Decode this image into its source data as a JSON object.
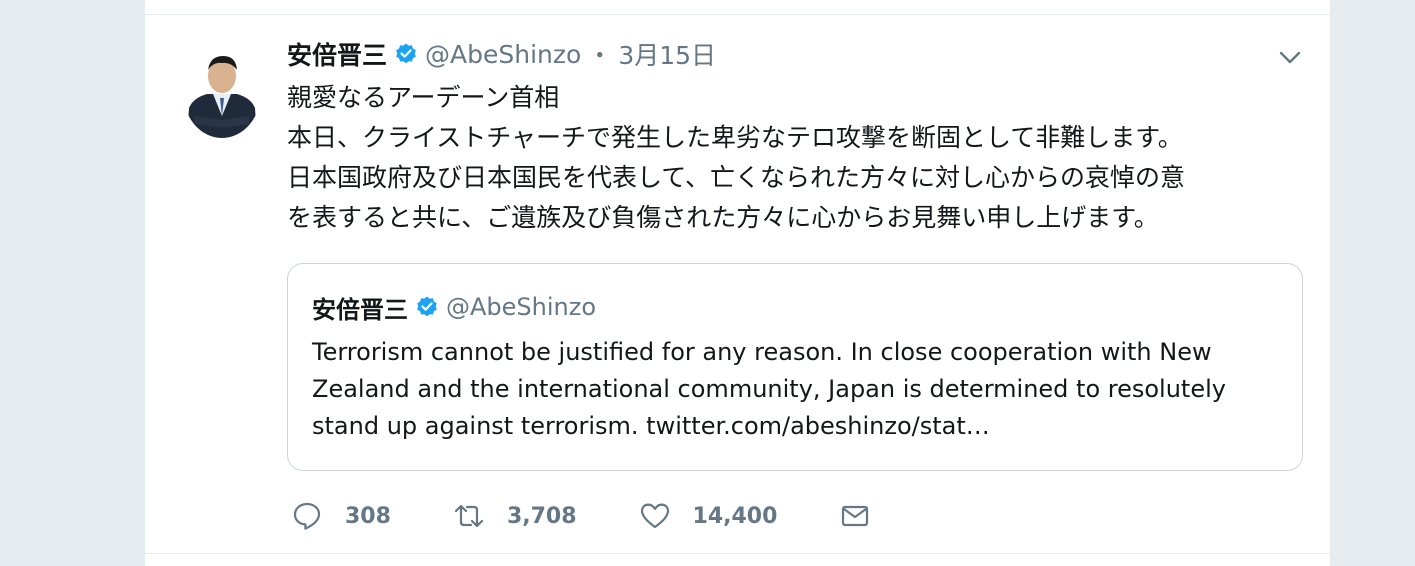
{
  "tweet": {
    "author_name": "安倍晋三",
    "handle": "@AbeShinzo",
    "separator": "・",
    "date": "3月15日",
    "lines": [
      "親愛なるアーデーン首相",
      "本日、クライストチャーチで発生した卑劣なテロ攻撃を断固として非難します。",
      "日本国政府及び日本国民を代表して、亡くなられた方々に対し心からの哀悼の意",
      "を表すると共に、ご遺族及び負傷された方々に心からお見舞い申し上げます。"
    ]
  },
  "quoted_tweet": {
    "author_name": "安倍晋三",
    "handle": "@AbeShinzo",
    "lines": [
      "Terrorism cannot be justified for any reason. In close cooperation with New",
      "Zealand and the international community, Japan is determined to resolutely",
      "stand up against terrorism. twitter.com/abeshinzo/stat…"
    ]
  },
  "actions": {
    "reply_count": "308",
    "retweet_count": "3,708",
    "like_count": "14,400"
  },
  "icons": {
    "verified": "verified-badge-icon",
    "menu": "chevron-down-icon",
    "reply": "reply-icon",
    "retweet": "retweet-icon",
    "like": "heart-icon",
    "dm": "mail-icon"
  },
  "colors": {
    "accent": "#1da1f2",
    "secondary_text": "#657786",
    "border": "#ccd6dd",
    "page_background": "#e6ecf0"
  }
}
